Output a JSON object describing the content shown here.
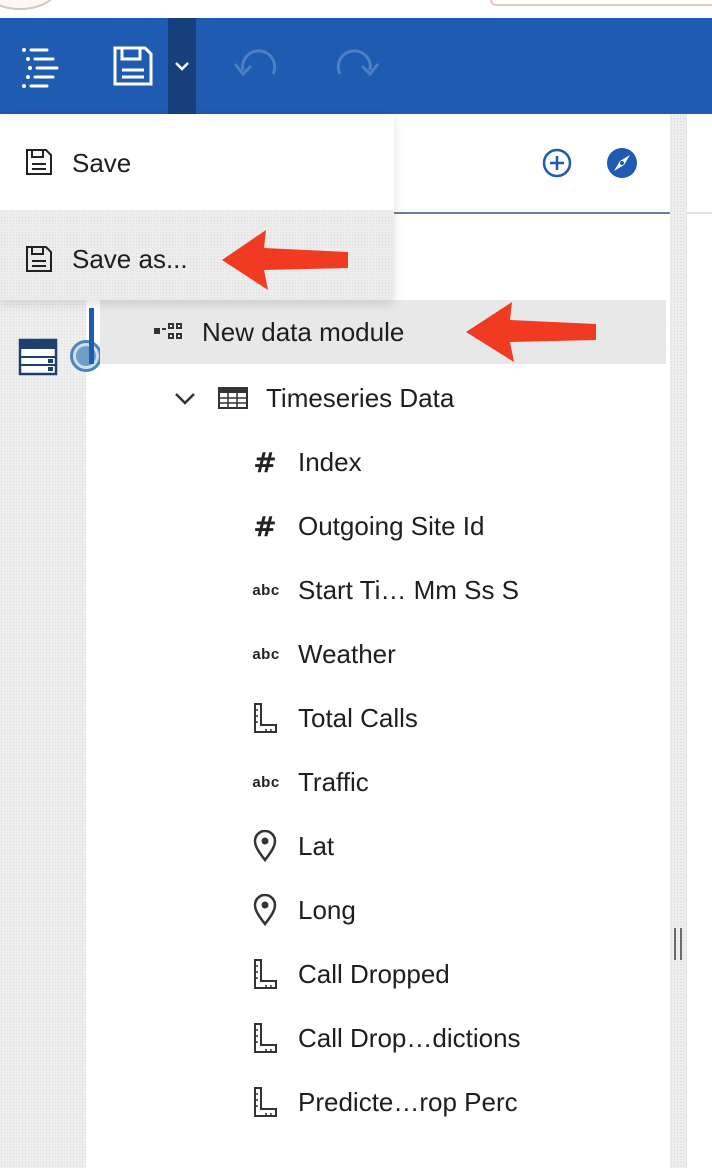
{
  "toolbar": {
    "menu_icon": "navigation-menu-icon",
    "save_icon": "floppy-disk-icon",
    "caret_icon": "chevron-down-icon",
    "undo_icon": "undo-icon",
    "redo_icon": "redo-icon"
  },
  "save_menu": {
    "items": [
      {
        "label": "Save",
        "icon": "floppy-disk-icon"
      },
      {
        "label": "Save as...",
        "icon": "floppy-disk-icon",
        "highlighted": true
      }
    ]
  },
  "panel_header": {
    "add_icon": "add-circle-icon",
    "navigate_icon": "compass-icon"
  },
  "tree": {
    "module": {
      "label": "New data module",
      "icon": "data-module-icon"
    },
    "table": {
      "label": "Timeseries Data",
      "icon": "table-icon",
      "expand_icon": "chevron-down-icon"
    },
    "columns": [
      {
        "label": "Index",
        "type_icon": "hash-icon"
      },
      {
        "label": "Outgoing Site Id",
        "type_icon": "hash-icon"
      },
      {
        "label": "Start Ti… Mm Ss S",
        "type_icon": "text-abc-icon"
      },
      {
        "label": "Weather",
        "type_icon": "text-abc-icon"
      },
      {
        "label": "Total Calls",
        "type_icon": "measure-ruler-icon"
      },
      {
        "label": "Traffic",
        "type_icon": "text-abc-icon"
      },
      {
        "label": "Lat",
        "type_icon": "location-pin-icon"
      },
      {
        "label": "Long",
        "type_icon": "location-pin-icon"
      },
      {
        "label": "Call Dropped",
        "type_icon": "measure-ruler-icon"
      },
      {
        "label": "Call Drop…dictions",
        "type_icon": "measure-ruler-icon"
      },
      {
        "label": "Predicte…rop Perc",
        "type_icon": "measure-ruler-icon"
      }
    ],
    "abc_glyph": "abc",
    "hash_glyph": "#"
  },
  "colors": {
    "toolbar": "#1f5bb0",
    "accent": "#1f5bb0",
    "annotation_arrow": "#f03a22"
  }
}
